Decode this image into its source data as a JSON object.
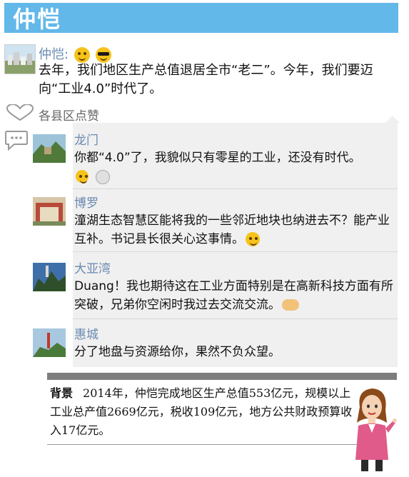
{
  "banner": {
    "title": "仲恺"
  },
  "post": {
    "author": "仲恺:",
    "emojis": [
      "grin-face-icon",
      "sunglasses-face-icon"
    ],
    "text": "去年，我们地区生产总值退居全市“老二”。今年，我们要迈向“工业4.0”时代了。"
  },
  "likes": {
    "label": "各县区点赞"
  },
  "comments": [
    {
      "name": "龙门",
      "text": "你都“4.0”了，我貌似只有零星的工业，还没有时代。"
    },
    {
      "name": "博罗",
      "text": "潼湖生态智慧区能将我的一些邻近地块也纳进去不？能产业互补。书记县长很关心这事情。"
    },
    {
      "name": "大亚湾",
      "text": "Duang！我也期待这在工业方面特别是在高新科技方面有所突破，兄弟你空闲时我过去交流交流。"
    },
    {
      "name": "惠城",
      "text": "分了地盘与资源给你，果然不负众望。"
    }
  ],
  "background": {
    "label": "背景",
    "text": "2014年，仲恺完成地区生产总值553亿元，规模以上工业总产值2669亿元，税收109亿元，地方公共财政预算收入17亿元。"
  },
  "colors": {
    "banner": "#62b8e8",
    "name": "#6a8ab0",
    "panel": "#f0f0f0"
  }
}
